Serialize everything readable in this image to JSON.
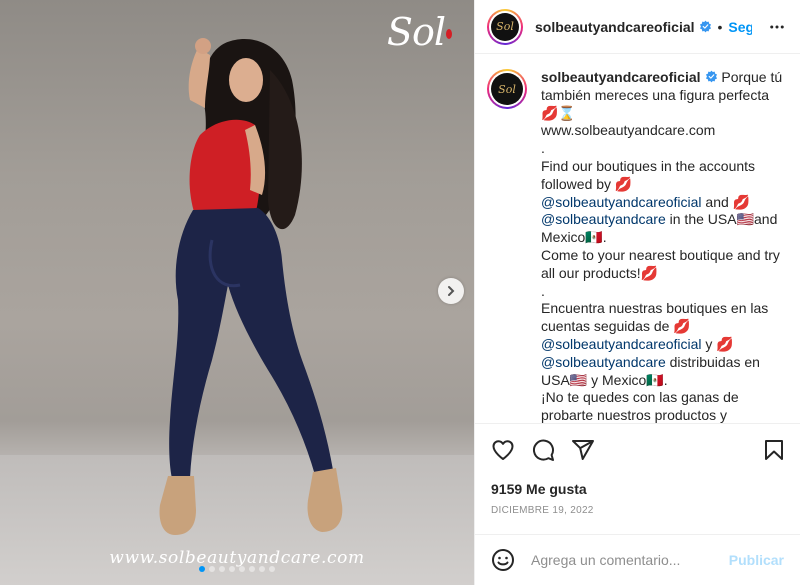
{
  "post": {
    "brand_logo": "Sol",
    "photo_url_text": "www.solbeautyandcare.com",
    "carousel": {
      "count": 8,
      "active_index": 0
    }
  },
  "header": {
    "username": "solbeautyandcareoficial",
    "separator": "•",
    "follow_label": "Seguir"
  },
  "caption": {
    "username": "solbeautyandcareoficial",
    "line1": " Porque tú también mereces una figura perfecta 💋⌛",
    "line2": "www.solbeautyandcare.com",
    "line3": ".",
    "line4": "Find our boutiques in the accounts followed by 💋 ",
    "mention1": "@solbeautyandcareoficial",
    "line5": " and 💋 ",
    "mention2": "@solbeautyandcare",
    "line6": " in the USA🇺🇸and Mexico🇲🇽.",
    "line7": "Come to your nearest boutique and try all our products!💋",
    "line8": ".",
    "line9": "Encuentra nuestras boutiques en las cuentas seguidas de 💋 ",
    "mention3": "@solbeautyandcareoficial",
    "line10": " y 💋 ",
    "mention4": "@solbeautyandcare",
    "line11": " distribuidas en USA🇺🇸 y Mexico🇲🇽.",
    "line12": "¡No te quedes con las ganas de probarte nuestros productos y"
  },
  "stats": {
    "likes": "9159 Me gusta",
    "date": "DICIEMBRE 19, 2022"
  },
  "comment": {
    "placeholder": "Agrega un comentario...",
    "publish_label": "Publicar"
  },
  "icons": {
    "like": "heart-icon",
    "comment": "comment-icon",
    "share": "share-icon",
    "save": "bookmark-icon",
    "verified": "verified-badge-icon",
    "more": "more-options-icon",
    "emoji": "emoji-icon",
    "next": "chevron-right-icon"
  },
  "colors": {
    "accent": "#0095f6",
    "verified": "#3897f0",
    "mention": "#00376b",
    "top_color": "#d51d24",
    "jeans": "#1d2447"
  }
}
